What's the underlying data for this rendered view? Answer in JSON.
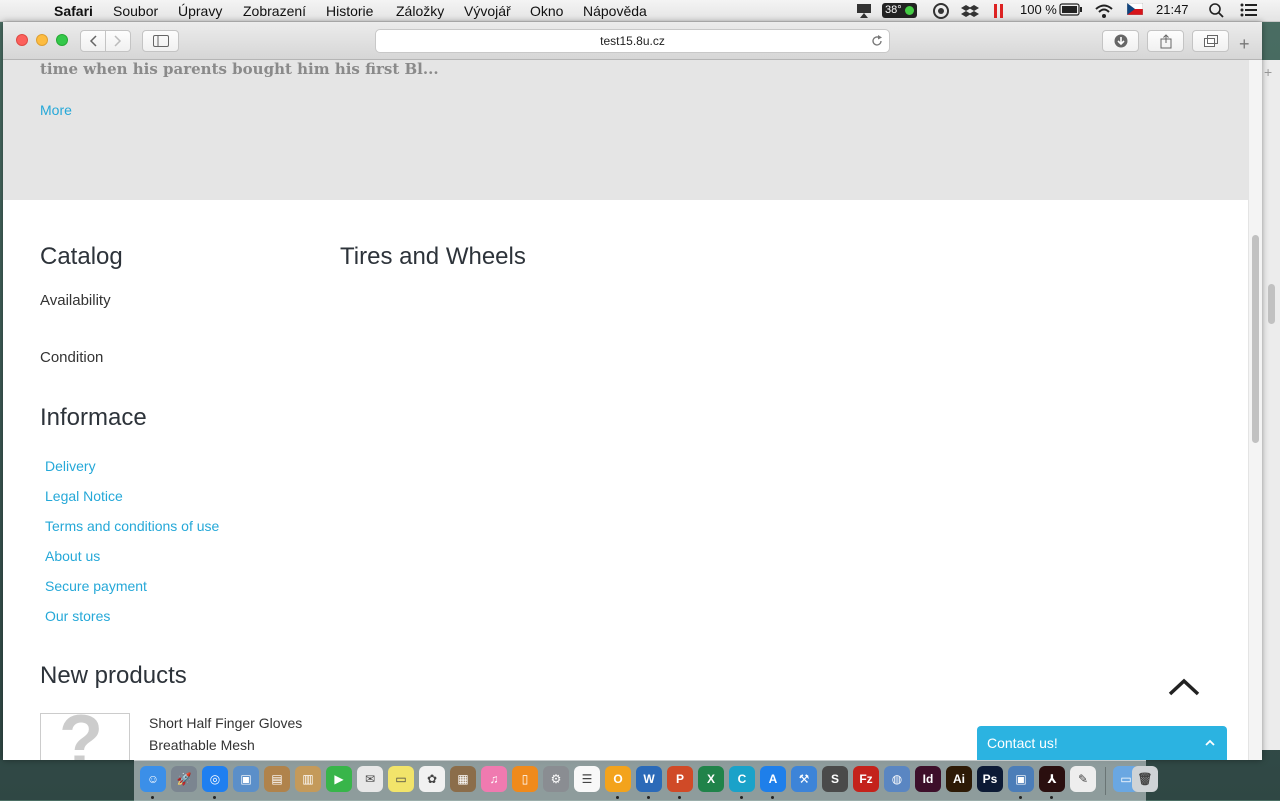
{
  "menubar": {
    "app_name": "Safari",
    "items": [
      "Soubor",
      "Úpravy",
      "Zobrazení",
      "Historie",
      "Záložky",
      "Vývojář",
      "Okno",
      "Nápověda"
    ],
    "temperature": "38°",
    "battery": "100 %",
    "clock": "21:47"
  },
  "browser": {
    "url": "test15.8u.cz"
  },
  "page": {
    "truncated_text": "time when his parents bought him his first Bl...",
    "more_label": "More",
    "catalog": {
      "title": "Catalog",
      "facets": [
        "Availability",
        "Condition"
      ]
    },
    "category_title": "Tires and Wheels",
    "informace": {
      "title": "Informace",
      "links": [
        "Delivery",
        "Legal Notice",
        "Terms and conditions of use",
        "About us",
        "Secure payment",
        "Our stores"
      ]
    },
    "new_products": {
      "title": "New products",
      "items": [
        {
          "name": "Short Half Finger Gloves Breathable Mesh",
          "thumb": "?"
        }
      ]
    },
    "contact_label": "Contact us!"
  },
  "dock": {
    "apps": [
      {
        "name": "Finder",
        "color": "#3b8fe8",
        "glyph": "☺"
      },
      {
        "name": "Launchpad",
        "color": "#7b8590",
        "glyph": "🚀"
      },
      {
        "name": "Safari",
        "color": "#1f7ff0",
        "glyph": "◎"
      },
      {
        "name": "Preview",
        "color": "#5b8fc9",
        "glyph": "▣"
      },
      {
        "name": "Contacts",
        "color": "#b0834b",
        "glyph": "▤"
      },
      {
        "name": "Notes",
        "color": "#c49a5a",
        "glyph": "▥"
      },
      {
        "name": "FaceTime",
        "color": "#38b54a",
        "glyph": "▶"
      },
      {
        "name": "Mail",
        "color": "#e8e8e8",
        "glyph": "✉"
      },
      {
        "name": "Stickies",
        "color": "#f2e46a",
        "glyph": "▭"
      },
      {
        "name": "Photos",
        "color": "#f1f1f1",
        "glyph": "✿"
      },
      {
        "name": "Image Capture",
        "color": "#8b6d4a",
        "glyph": "▦"
      },
      {
        "name": "iTunes",
        "color": "#f07ab0",
        "glyph": "♫"
      },
      {
        "name": "iBooks",
        "color": "#f08a1c",
        "glyph": "▯"
      },
      {
        "name": "System Preferences",
        "color": "#8a8d92",
        "glyph": "⚙"
      },
      {
        "name": "Reminders",
        "color": "#f8f8f8",
        "glyph": "☰"
      },
      {
        "name": "Office",
        "color": "#f3a31c",
        "glyph": "O"
      },
      {
        "name": "Word",
        "color": "#2b6ab8",
        "glyph": "W"
      },
      {
        "name": "PowerPoint",
        "color": "#d04a27",
        "glyph": "P"
      },
      {
        "name": "Excel",
        "color": "#20834a",
        "glyph": "X"
      },
      {
        "name": "Coda",
        "color": "#1aa2c9",
        "glyph": "C"
      },
      {
        "name": "App Store",
        "color": "#1e7fea",
        "glyph": "A"
      },
      {
        "name": "Xcode",
        "color": "#3d84d8",
        "glyph": "⚒"
      },
      {
        "name": "Sublime",
        "color": "#4a4a4a",
        "glyph": "S"
      },
      {
        "name": "FileZilla",
        "color": "#c4221b",
        "glyph": "Fz"
      },
      {
        "name": "Network",
        "color": "#5a86c2",
        "glyph": "◍"
      },
      {
        "name": "InDesign",
        "color": "#3d0f2a",
        "glyph": "Id"
      },
      {
        "name": "Illustrator",
        "color": "#2d1a06",
        "glyph": "Ai"
      },
      {
        "name": "Photoshop",
        "color": "#0c1a35",
        "glyph": "Ps"
      },
      {
        "name": "Screen Sharing",
        "color": "#4b7db8",
        "glyph": "▣"
      },
      {
        "name": "Acrobat",
        "color": "#2a0f0f",
        "glyph": "⅄"
      },
      {
        "name": "TextEdit",
        "color": "#eeeeee",
        "glyph": "✎"
      },
      {
        "name": "Downloads Folder",
        "color": "#6aa7e2",
        "glyph": "▭"
      },
      {
        "name": "Trash",
        "color": "#cfd3d6",
        "glyph": "🗑"
      }
    ]
  }
}
